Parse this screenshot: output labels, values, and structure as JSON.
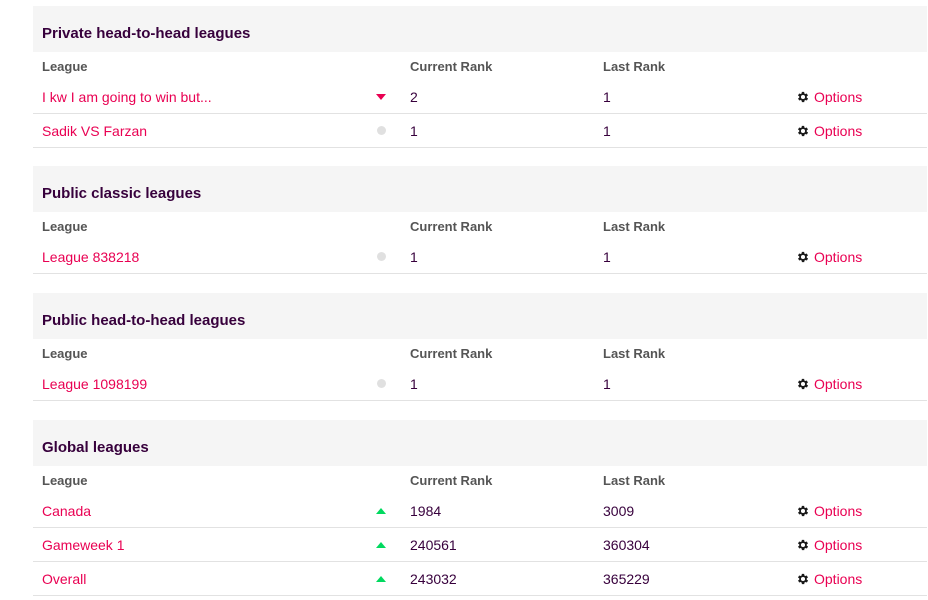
{
  "sections": [
    {
      "title": "Private head-to-head leagues",
      "columns": {
        "league": "League",
        "current": "Current Rank",
        "last": "Last Rank"
      },
      "rows": [
        {
          "name": "I kw I am going to win but...",
          "movement": "down",
          "current": "2",
          "last": "1",
          "options": "Options"
        },
        {
          "name": "Sadik VS Farzan",
          "movement": "same",
          "current": "1",
          "last": "1",
          "options": "Options"
        }
      ]
    },
    {
      "title": "Public classic leagues",
      "columns": {
        "league": "League",
        "current": "Current Rank",
        "last": "Last Rank"
      },
      "rows": [
        {
          "name": "League 838218",
          "movement": "same",
          "current": "1",
          "last": "1",
          "options": "Options"
        }
      ]
    },
    {
      "title": "Public head-to-head leagues",
      "columns": {
        "league": "League",
        "current": "Current Rank",
        "last": "Last Rank"
      },
      "rows": [
        {
          "name": "League 1098199",
          "movement": "same",
          "current": "1",
          "last": "1",
          "options": "Options"
        }
      ]
    },
    {
      "title": "Global leagues",
      "columns": {
        "league": "League",
        "current": "Current Rank",
        "last": "Last Rank"
      },
      "rows": [
        {
          "name": "Canada",
          "movement": "up",
          "current": "1984",
          "last": "3009",
          "options": "Options"
        },
        {
          "name": "Gameweek 1",
          "movement": "up",
          "current": "240561",
          "last": "360304",
          "options": "Options"
        },
        {
          "name": "Overall",
          "movement": "up",
          "current": "243032",
          "last": "365229",
          "options": "Options"
        }
      ]
    }
  ],
  "icons": {
    "options": "gear-icon",
    "up": "triangle-up-icon",
    "down": "triangle-down-icon",
    "same": "dot-icon"
  },
  "colors": {
    "link": "#e90052",
    "up": "#01d95f",
    "down": "#e90052",
    "same": "#e0e0e0",
    "header_bg": "#f5f5f5"
  }
}
